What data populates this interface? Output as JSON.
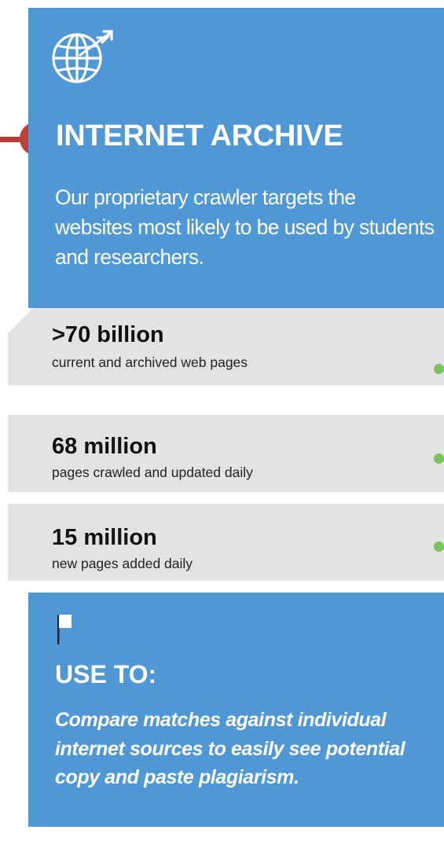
{
  "header": {
    "icon": "globe-with-arrow-icon",
    "title": "INTERNET ARCHIVE",
    "description": "Our proprietary crawler targets the websites most likely to be used by students and researchers."
  },
  "stats": [
    {
      "value": ">70 billion",
      "label": "current and archived web pages"
    },
    {
      "value": "68 million",
      "label": "pages crawled and updated daily"
    },
    {
      "value": "15 million",
      "label": "new pages added daily"
    }
  ],
  "use_section": {
    "icon": "flag-icon",
    "title": "USE TO:",
    "description": "Compare matches against individual internet sources to easily see potential copy and paste plagiarism."
  },
  "colors": {
    "panel_blue": "#4f98d5",
    "stat_gray": "#e3e3e3",
    "connector_red": "#bf403a",
    "dot_green": "#7cc35b"
  }
}
